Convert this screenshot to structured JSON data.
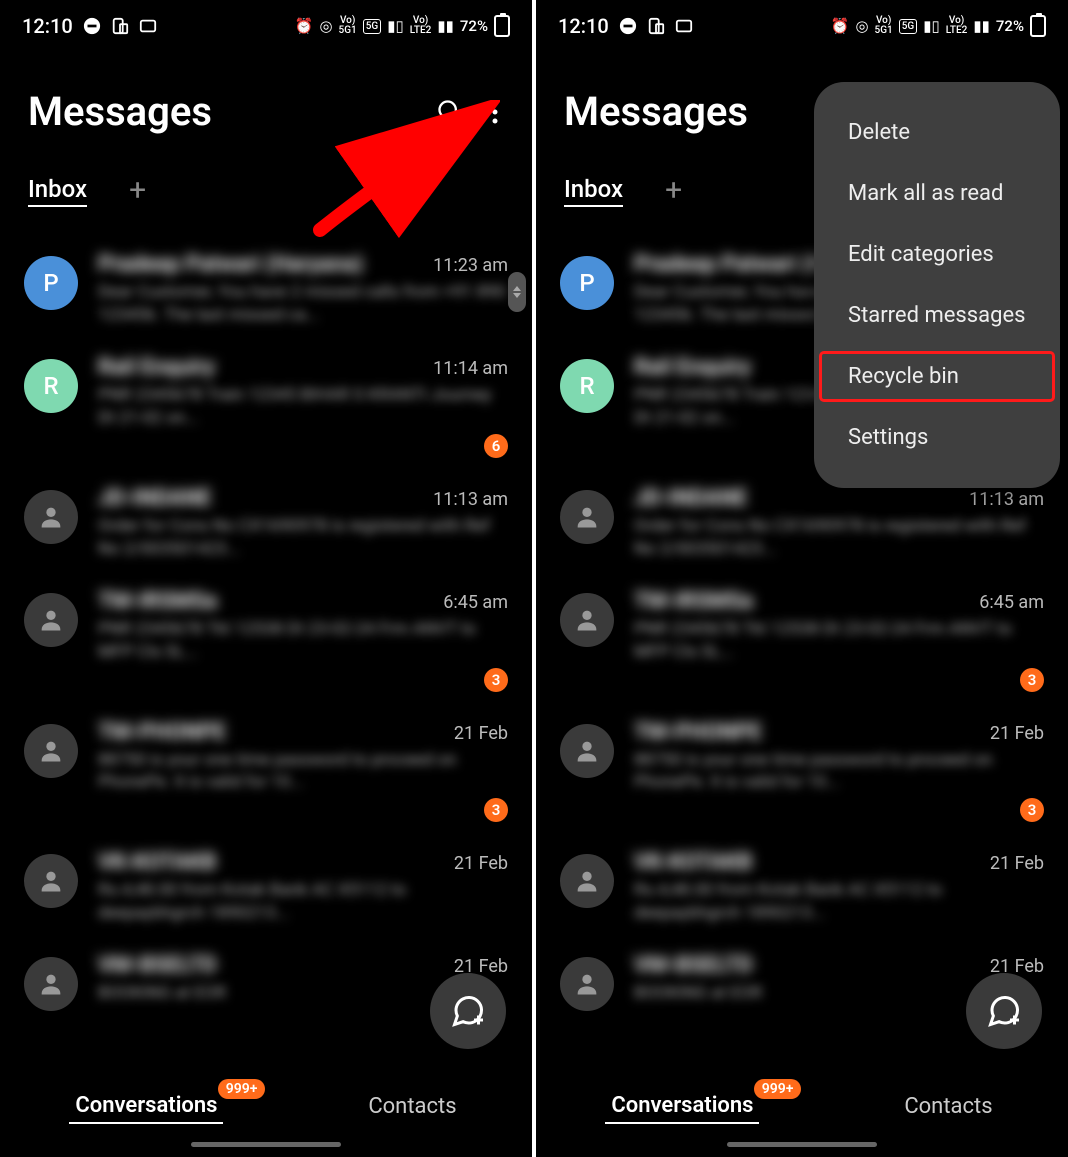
{
  "status": {
    "time": "12:10",
    "battery_text": "72%"
  },
  "header": {
    "title": "Messages"
  },
  "filter": {
    "inbox_label": "Inbox"
  },
  "conversations": [
    {
      "avatar_letter": "P",
      "avatar_bg": "#4a90d9",
      "name": "Pradeep Patwari (Haryana)",
      "time": "11:23 am",
      "preview": "Dear Customer, You have 2 missed calls from +91 890 123456. The last missed ca...",
      "badge": ""
    },
    {
      "avatar_letter": "R",
      "avatar_bg": "#7fd9b0",
      "name": "Rail Enquiry",
      "time": "11:14 am",
      "preview": "PNR 2345678 Train 12345 BIHAR S KRANTI Journey Dt 21-02 on...",
      "badge": "6"
    },
    {
      "avatar_letter": "",
      "avatar_bg": "person",
      "name": "JD-INDANE",
      "time": "11:13 am",
      "preview": "Order for Cons No CX1690978 is registered with Ref No 2/003501423...",
      "badge": ""
    },
    {
      "avatar_letter": "",
      "avatar_bg": "person",
      "name": "TM-IRSMSa",
      "time": "6:45 am",
      "preview": "PNR 2345678 Tkt 12538 Dt 23-02-24 Frm ANVT to MFP Cls SL...",
      "badge": "3"
    },
    {
      "avatar_letter": "",
      "avatar_bg": "person",
      "name": "TM-PHONPE",
      "time": "21 Feb",
      "preview": "88750 is your one time password to proceed on PhonePe. It is valid for 10...",
      "badge": "3"
    },
    {
      "avatar_letter": "",
      "avatar_bg": "person",
      "name": "VK-KOTAKB",
      "time": "21 Feb",
      "preview": "Rs.4,48.00 from Kotak Bank AC X5112 to deepaybhgrch 1890213...",
      "badge": ""
    },
    {
      "avatar_letter": "",
      "avatar_bg": "person",
      "name": "VM-BSELTD",
      "time": "21 Feb",
      "preview": "BOOKING at EOR",
      "badge": ""
    }
  ],
  "bottom_nav": {
    "conversations_label": "Conversations",
    "conversations_badge": "999+",
    "contacts_label": "Contacts"
  },
  "menu": {
    "items": [
      {
        "label": "Delete"
      },
      {
        "label": "Mark all as read"
      },
      {
        "label": "Edit categories"
      },
      {
        "label": "Starred messages"
      },
      {
        "label": "Recycle bin"
      },
      {
        "label": "Settings"
      }
    ],
    "highlighted_index": 4
  }
}
